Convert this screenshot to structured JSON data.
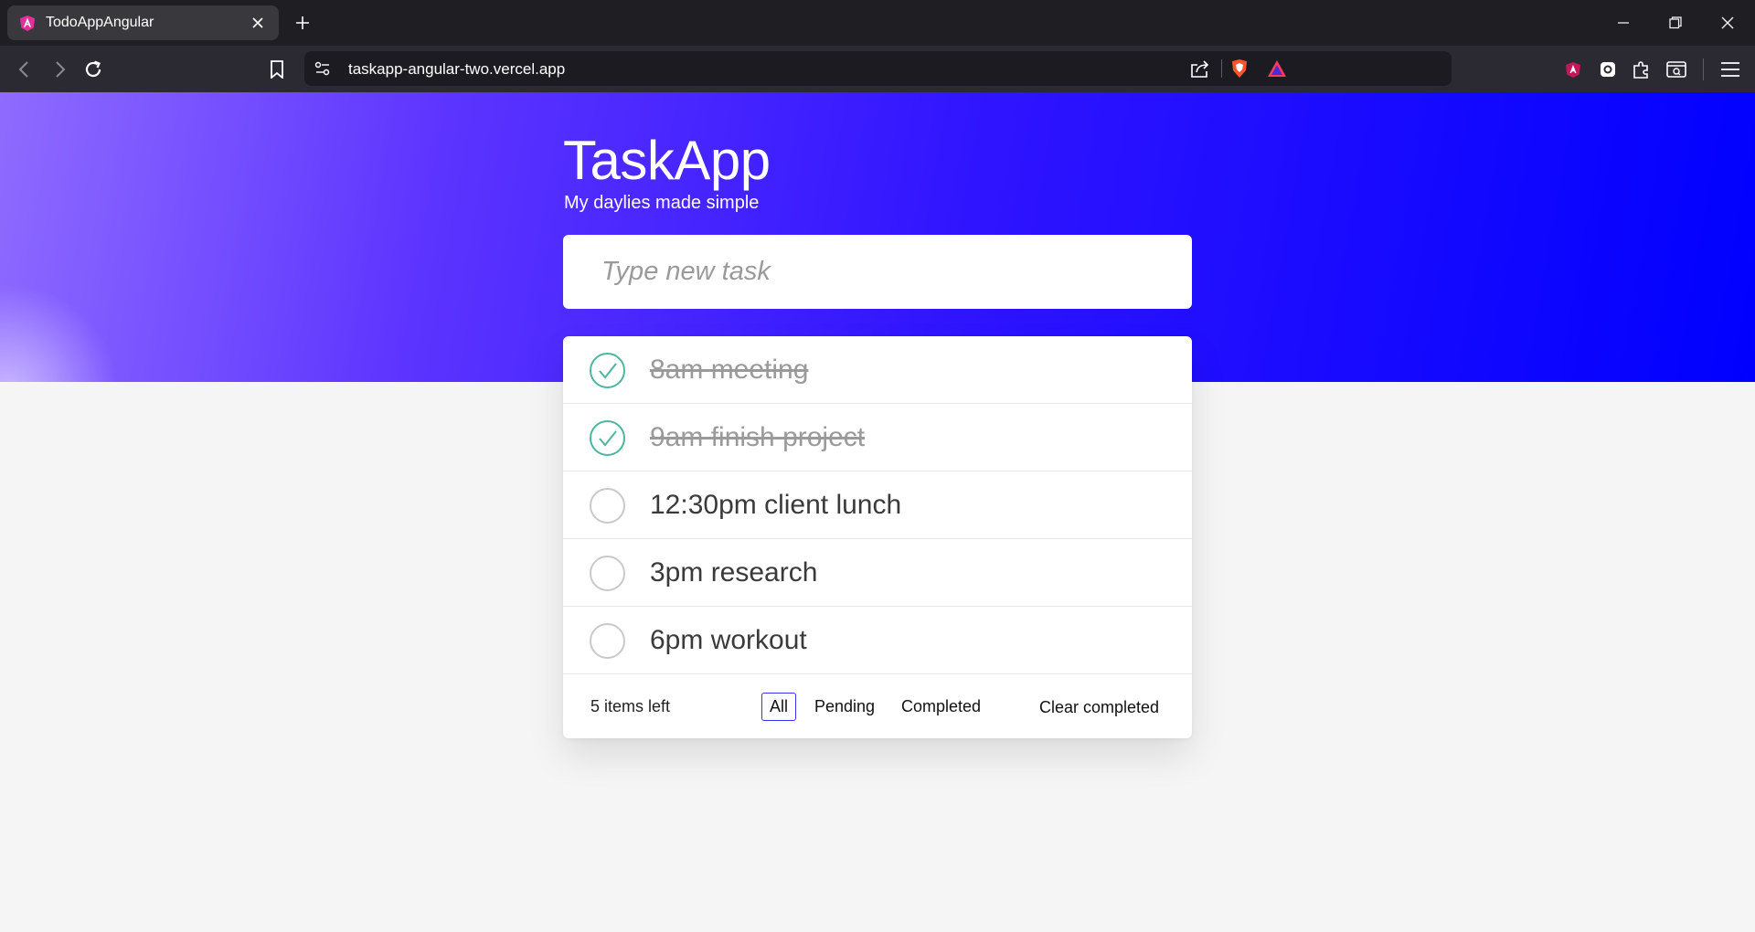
{
  "browser": {
    "tab_title": "TodoAppAngular",
    "url": "taskapp-angular-two.vercel.app"
  },
  "app": {
    "title": "TaskApp",
    "subtitle": "My daylies made simple",
    "new_task_placeholder": "Type new task"
  },
  "todos": [
    {
      "text": "8am meeting",
      "completed": true
    },
    {
      "text": "9am finish project",
      "completed": true
    },
    {
      "text": "12:30pm client lunch",
      "completed": false
    },
    {
      "text": "3pm research",
      "completed": false
    },
    {
      "text": "6pm workout",
      "completed": false
    }
  ],
  "footer": {
    "items_left": "5 items left",
    "filters": [
      "All",
      "Pending",
      "Completed"
    ],
    "active_filter": "All",
    "clear_completed": "Clear completed"
  },
  "colors": {
    "hero_start": "#8f6bff",
    "hero_end": "#0000ff",
    "check_done": "#4fb5a0",
    "active_filter_border": "#3a2ff5",
    "chrome_dark": "#1f1f23",
    "toolbar": "#2b2a33"
  }
}
